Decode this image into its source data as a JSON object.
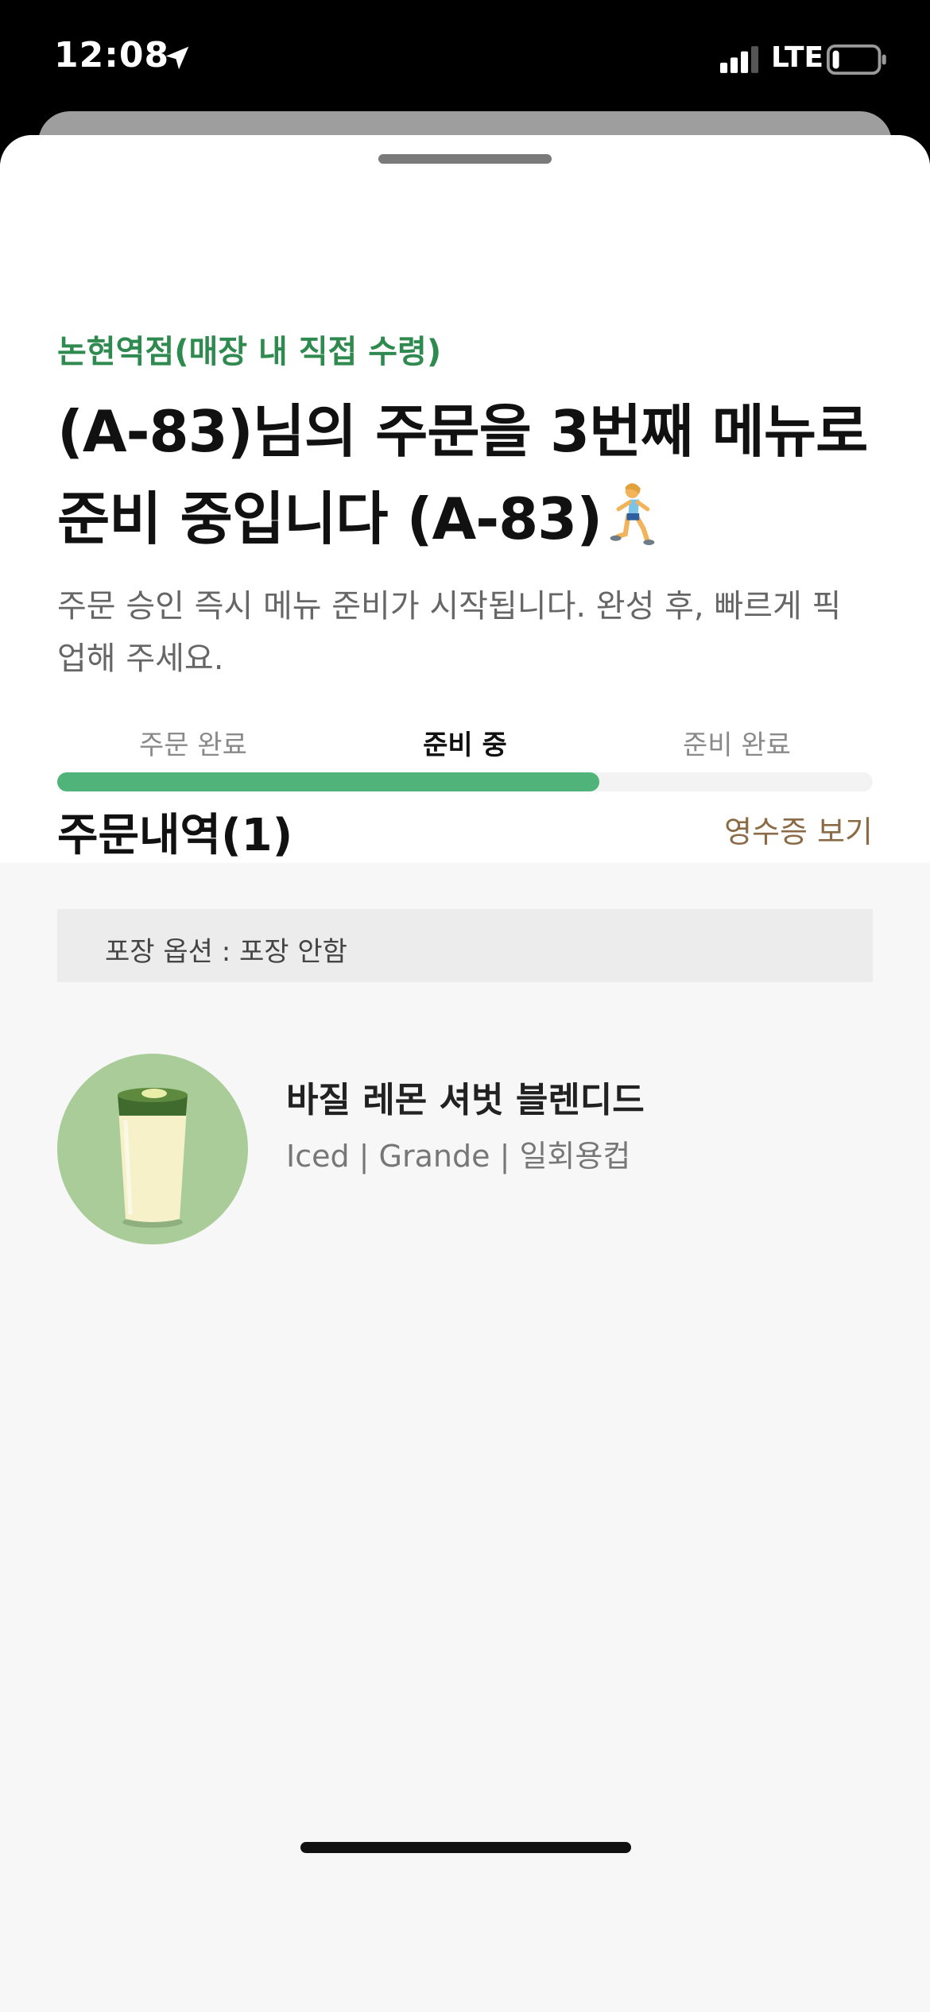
{
  "status_bar": {
    "time": "12:08",
    "network": "LTE",
    "location_icon": "location-arrow-icon",
    "signal_icon": "signal-bars-icon",
    "battery_icon": "battery-low-icon",
    "battery_level": 0.15
  },
  "order_status": {
    "store": "논현역점(매장 내 직접 수령)",
    "headline": " (A-83)님의 주문을 3번째 메뉴로 준비 중입니다 (A-83)",
    "headline_icon": "woman-running-emoji",
    "subtext": "주문 승인 즉시 메뉴 준비가 시작됩니다. 완성 후, 빠르게 픽업해 주세요.",
    "steps": [
      "주문 완료",
      "준비 중",
      "준비 완료"
    ],
    "active_step": 1,
    "progress": 0.665,
    "progress_color": "#4fb37a"
  },
  "order_history": {
    "title": "주문내역(1)",
    "receipt_link": "영수증 보기",
    "packaging": "포장 옵션 : 포장 안함",
    "items": [
      {
        "name": "바질 레몬 셔벗 블렌디드",
        "options": "Iced | Grande | 일회용컵",
        "image_icon": "blended-drink-cup-image"
      }
    ]
  },
  "colors": {
    "accent_green": "#2f8a4f",
    "link_brown": "#8b6b46"
  }
}
